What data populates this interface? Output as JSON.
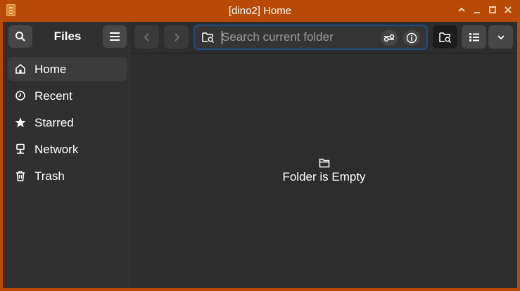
{
  "window": {
    "title": "[dino2] Home",
    "accent": "#b84a06"
  },
  "sidebar": {
    "title": "Files",
    "items": [
      {
        "label": "Home",
        "icon": "home-icon",
        "active": true
      },
      {
        "label": "Recent",
        "icon": "clock-icon"
      },
      {
        "label": "Starred",
        "icon": "star-icon"
      },
      {
        "label": "Network",
        "icon": "network-icon"
      },
      {
        "label": "Trash",
        "icon": "trash-icon"
      }
    ]
  },
  "search": {
    "placeholder": "Search current folder"
  },
  "main": {
    "empty_label": "Folder is Empty"
  }
}
